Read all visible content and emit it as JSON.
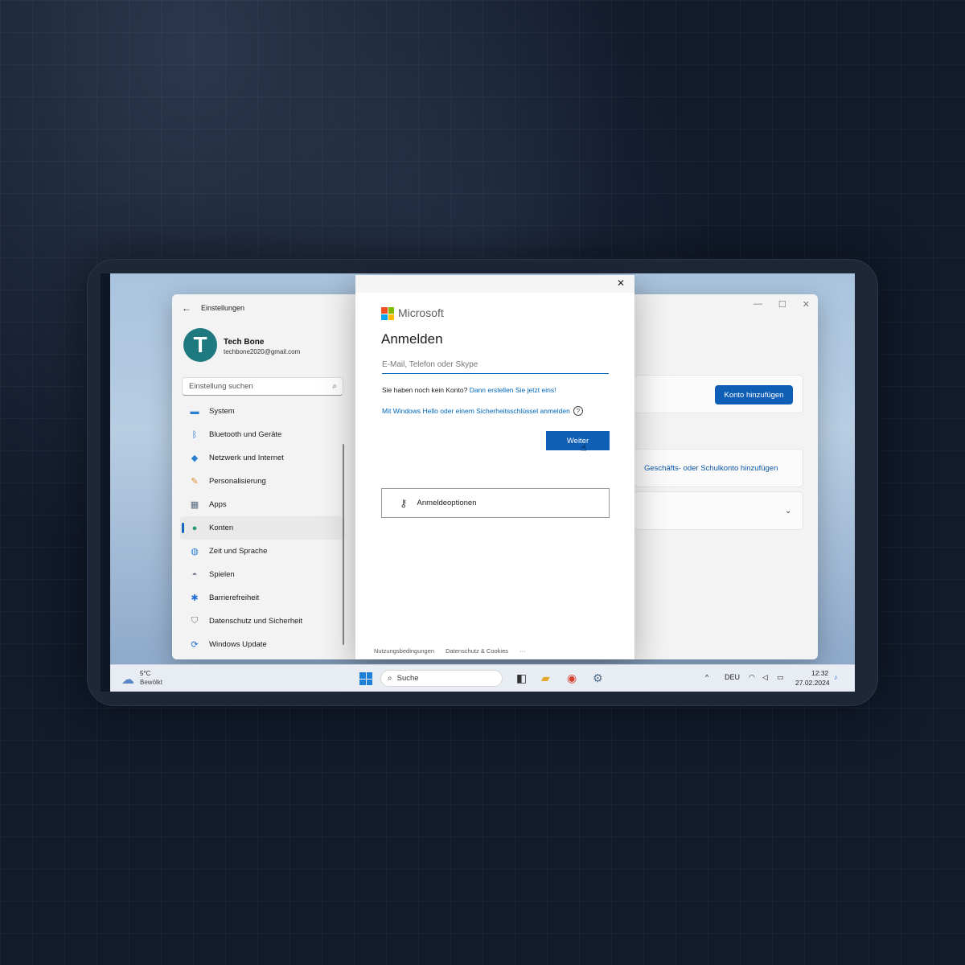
{
  "settings": {
    "title": "Einstellungen",
    "user": {
      "initial": "T",
      "name": "Tech Bone",
      "email": "techbone2020@gmail.com"
    },
    "search_placeholder": "Einstellung suchen",
    "nav": [
      {
        "label": "System",
        "icon": "monitor-icon"
      },
      {
        "label": "Bluetooth und Geräte",
        "icon": "bluetooth-icon"
      },
      {
        "label": "Netzwerk und Internet",
        "icon": "wifi-icon"
      },
      {
        "label": "Personalisierung",
        "icon": "brush-icon"
      },
      {
        "label": "Apps",
        "icon": "apps-icon"
      },
      {
        "label": "Konten",
        "icon": "person-icon",
        "active": true
      },
      {
        "label": "Zeit und Sprache",
        "icon": "globe-icon"
      },
      {
        "label": "Spielen",
        "icon": "gamepad-icon"
      },
      {
        "label": "Barrierefreiheit",
        "icon": "accessibility-icon"
      },
      {
        "label": "Datenschutz und Sicherheit",
        "icon": "shield-icon"
      },
      {
        "label": "Windows Update",
        "icon": "update-icon"
      }
    ],
    "add_account_button": "Konto hinzufügen",
    "add_work_account_link": "Geschäfts- oder Schulkonto hinzufügen"
  },
  "dialog": {
    "brand": "Microsoft",
    "heading": "Anmelden",
    "email_placeholder": "E-Mail, Telefon oder Skype",
    "no_account_text": "Sie haben noch kein Konto?",
    "create_link": "Dann erstellen Sie jetzt eins!",
    "hello_link": "Mit Windows Hello oder einem Sicherheitsschlüssel anmelden",
    "next_button": "Weiter",
    "options_button": "Anmeldeoptionen",
    "footer": {
      "terms": "Nutzungsbedingungen",
      "privacy": "Datenschutz & Cookies",
      "more": "···"
    },
    "logo_colors": [
      "#f25022",
      "#7fba00",
      "#00a4ef",
      "#ffb900"
    ]
  },
  "taskbar": {
    "weather_temp": "5°C",
    "weather_desc": "Bewölkt",
    "search_label": "Suche",
    "language": "DEU",
    "time": "12:32",
    "date": "27.02.2024"
  },
  "colors": {
    "accent": "#0f5fb6",
    "link": "#0067b8"
  }
}
